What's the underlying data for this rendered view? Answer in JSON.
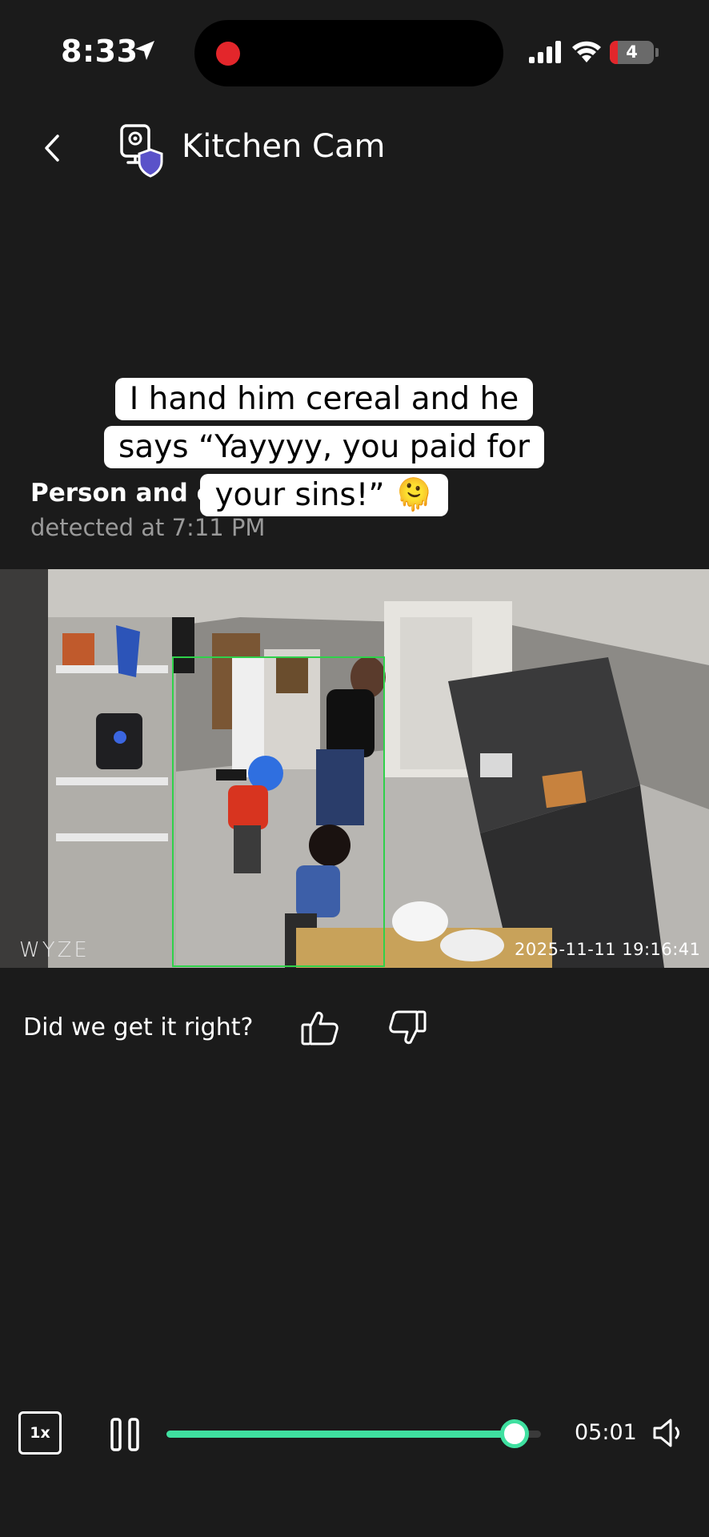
{
  "status_bar": {
    "time": "8:33",
    "battery": "4"
  },
  "header": {
    "title": "Kitchen Cam"
  },
  "caption": {
    "lines": [
      "I hand him cereal and he",
      "says “Yayyyy, you paid for",
      "your sins!” 🫠"
    ]
  },
  "detection": {
    "title": "Person and o",
    "subtitle": "detected at 7:11 PM"
  },
  "video": {
    "watermark": "WYZE",
    "timestamp": "2025-11-11  19:16:41"
  },
  "feedback": {
    "question": "Did we get it right?"
  },
  "player": {
    "speed": "1x",
    "elapsed": "05:01",
    "progress_fraction": 0.93
  },
  "colors": {
    "accent": "#3fe0a0",
    "background": "#1b1b1b",
    "record": "#e3262b",
    "shield": "#5a52c9"
  },
  "icons": [
    "location-arrow-icon",
    "signal-icon",
    "wifi-icon",
    "chevron-left-icon",
    "camera-shield-icon",
    "thumbs-up-icon",
    "thumbs-down-icon",
    "pause-icon",
    "volume-icon"
  ]
}
